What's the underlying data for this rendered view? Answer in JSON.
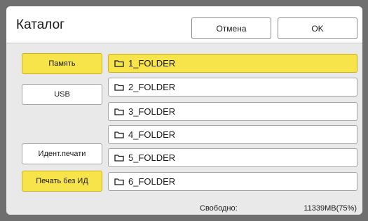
{
  "dialog": {
    "title": "Каталог",
    "cancel_label": "Отмена",
    "ok_label": "OK"
  },
  "sidebar": {
    "items": [
      {
        "label": "Память",
        "selected": true
      },
      {
        "label": "USB",
        "selected": false
      },
      {
        "label": "Идент.печати",
        "selected": false
      },
      {
        "label": "Печать без ИД",
        "selected": true
      }
    ]
  },
  "folders": [
    {
      "name": "1_FOLDER",
      "selected": true,
      "icon": "folder-icon"
    },
    {
      "name": "2_FOLDER",
      "selected": false,
      "icon": "folder-icon"
    },
    {
      "name": "3_FOLDER",
      "selected": false,
      "icon": "folder-icon"
    },
    {
      "name": "4_FOLDER",
      "selected": false,
      "icon": "folder-icon"
    },
    {
      "name": "5_FOLDER",
      "selected": false,
      "icon": "folder-icon"
    },
    {
      "name": "6_FOLDER",
      "selected": false,
      "icon": "folder-icon"
    }
  ],
  "footer": {
    "free_label": "Свободно:",
    "free_value": "11339MB(75%)"
  },
  "colors": {
    "selected": "#f7e34a",
    "background": "#e9e9e9",
    "frame": "#6f6f6f"
  }
}
